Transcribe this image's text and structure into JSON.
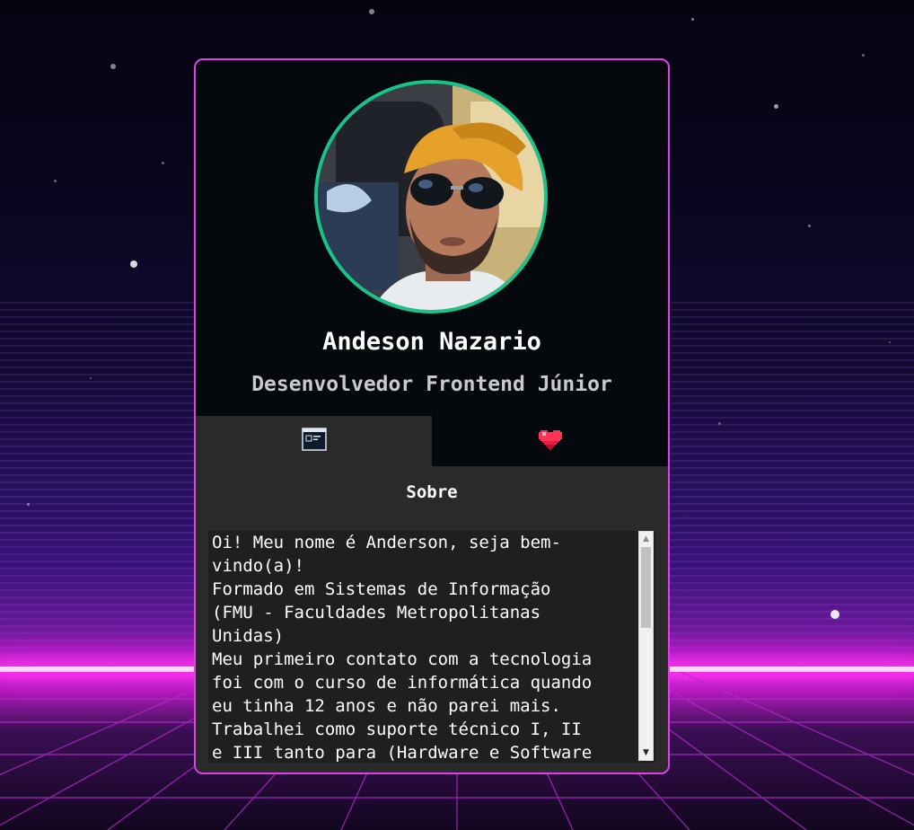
{
  "profile": {
    "name": "Andeson Nazario",
    "role": "Desenvolvedor Frontend Júnior",
    "avatar_alt": "Foto de perfil"
  },
  "tabs": [
    {
      "icon": "terminal-window-icon",
      "active": true
    },
    {
      "icon": "pixel-heart-icon",
      "active": false
    }
  ],
  "panel": {
    "title": "Sobre",
    "about_text": "Oi! Meu nome é Anderson, seja bem-\nvindo(a)!\nFormado em Sistemas de Informação\n(FMU - Faculdades Metropolitanas\nUnidas)\nMeu primeiro contato com a tecnologia\nfoi com o curso de informática quando\neu tinha 12 anos e não parei mais.\nTrabalhei como suporte técnico I, II\ne III tanto para (Hardware e Software"
  },
  "colors": {
    "card_border": "#e040e6",
    "avatar_ring": "#18c48a",
    "card_bg": "#05090e",
    "panel_bg": "#2a2a2a"
  }
}
